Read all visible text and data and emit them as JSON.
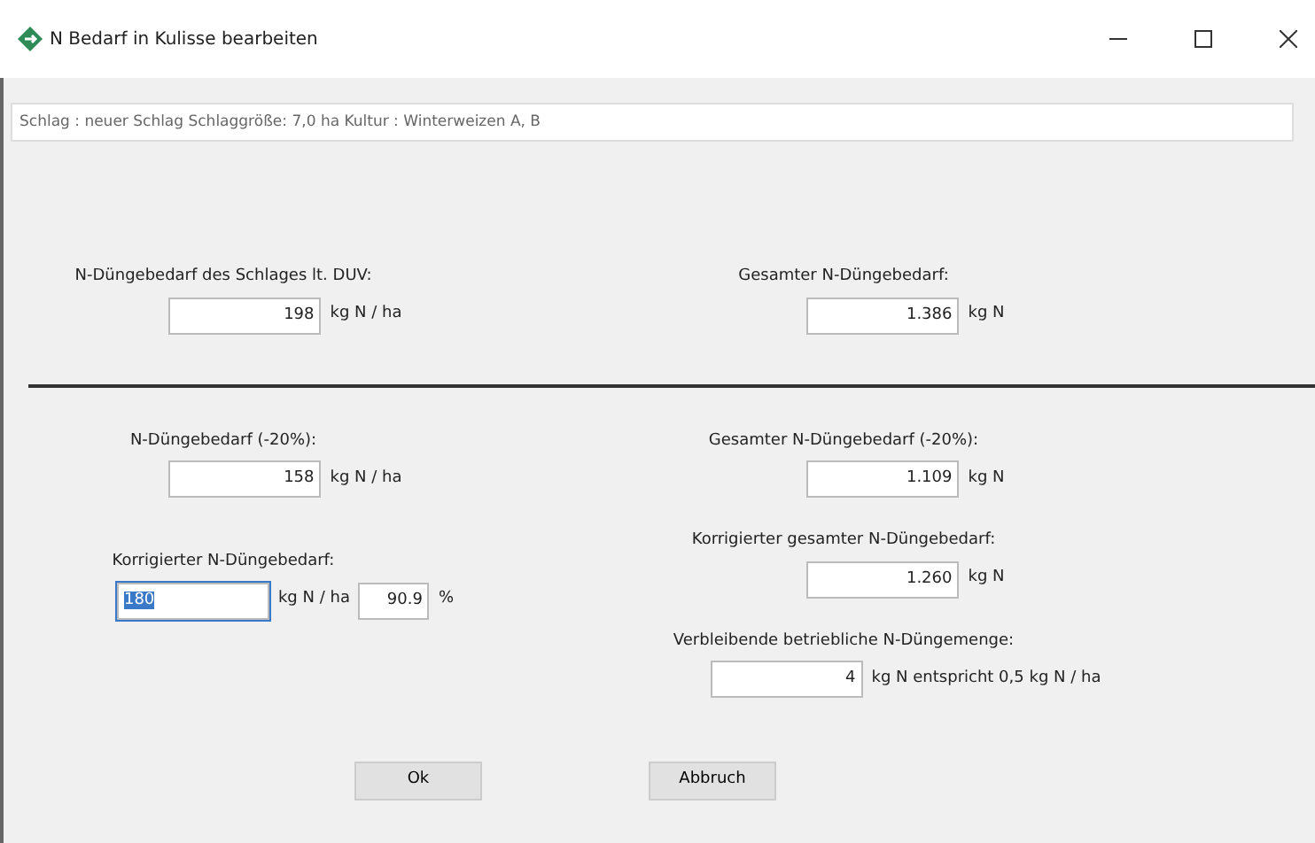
{
  "window": {
    "title": "N Bedarf in Kulisse bearbeiten"
  },
  "info": "Schlag : neuer Schlag  Schlaggröße: 7,0 ha Kultur : Winterweizen A, B",
  "sections": [
    {
      "left": [
        {
          "label": "N-Düngebedarf des Schlages  lt. DUV:",
          "value": "198",
          "unit": "kg N / ha",
          "selected": false
        }
      ],
      "right": [
        {
          "label": "Gesamter N-Düngebedarf:",
          "value": "1.386",
          "unit": "kg N",
          "selected": false
        }
      ]
    },
    {
      "left": [
        {
          "label": "N-Düngebedarf (-20%):",
          "value": "158",
          "unit": "kg N / ha",
          "selected": false
        },
        {
          "label": "Korrigierter N-Düngebedarf:",
          "value": "180",
          "unit": "kg N / ha",
          "selected": true,
          "extra": {
            "value": "90.9",
            "unit": "%"
          }
        }
      ],
      "right": [
        {
          "label": "Gesamter N-Düngebedarf (-20%):",
          "value": "1.109",
          "unit": "kg N",
          "selected": false
        },
        {
          "label": "Korrigierter gesamter N-Düngebedarf:",
          "value": "1.260",
          "unit": "kg N",
          "selected": false
        },
        {
          "label": "Verbleibende betriebliche N-Düngemenge:",
          "value": "4",
          "unit": "kg N entspricht 0,5 kg N / ha",
          "selected": false
        }
      ]
    }
  ],
  "buttons": [
    "Ok",
    "Abbruch"
  ]
}
